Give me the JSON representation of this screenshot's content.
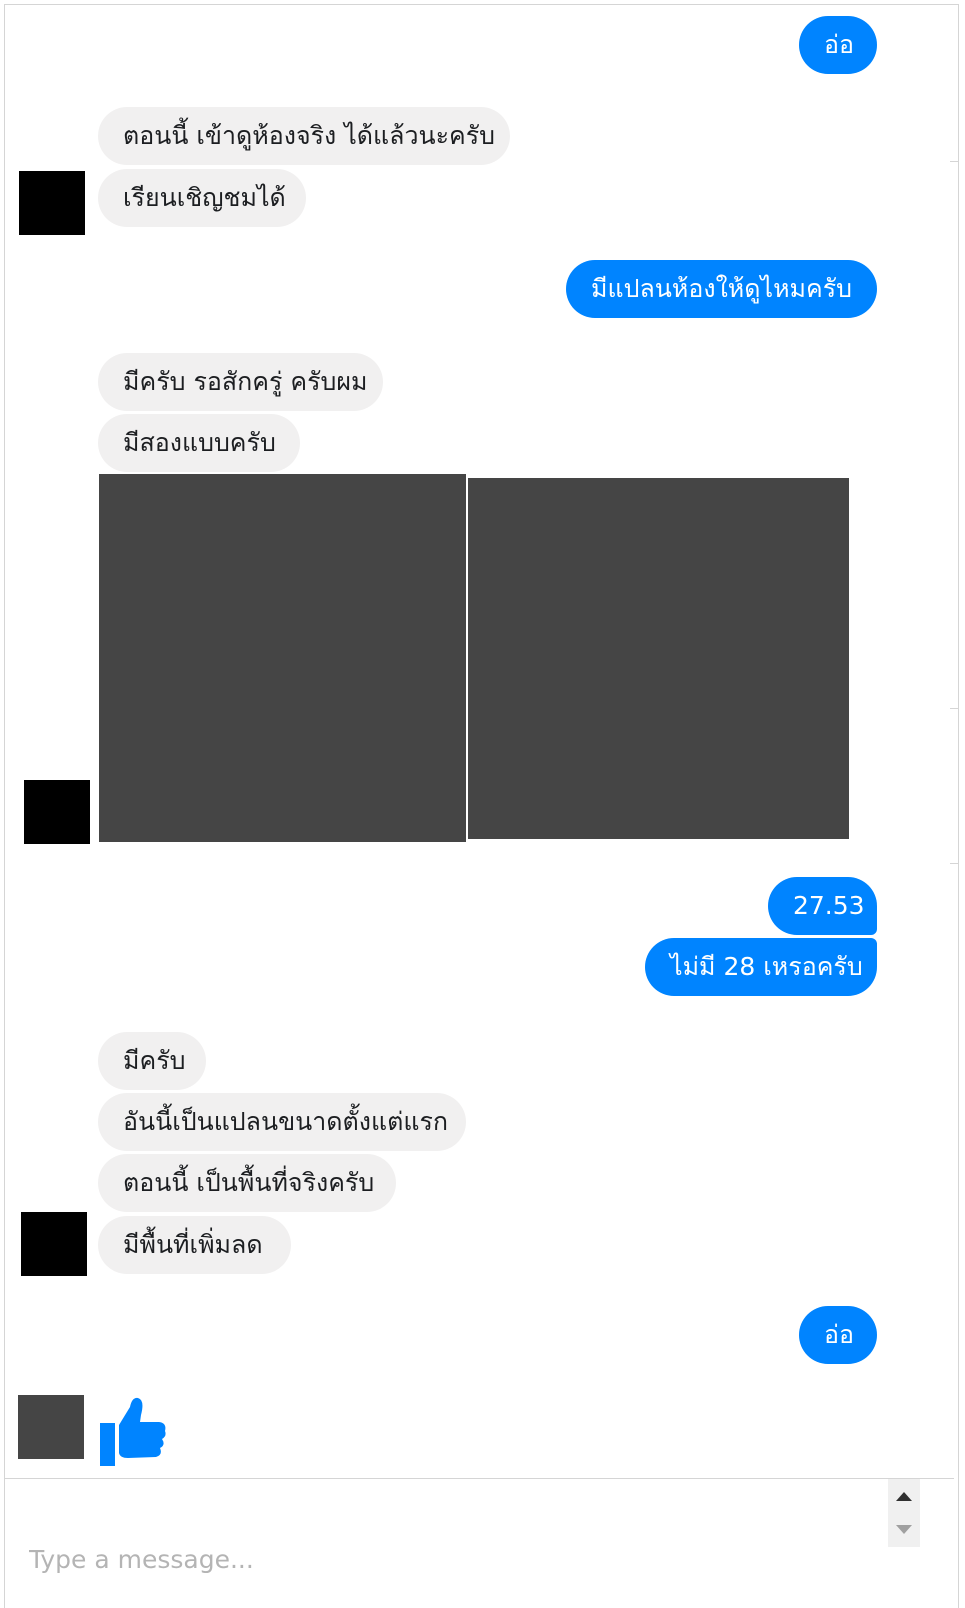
{
  "conversation": {
    "messages": [
      {
        "from": "me",
        "text": "อ่อ"
      },
      {
        "from": "other",
        "text": "ตอนนี้ เข้าดูห้องจริง ได้แล้วนะครับ"
      },
      {
        "from": "other",
        "text": "เรียนเชิญชมได้"
      },
      {
        "from": "me",
        "text": "มีแปลนห้องให้ดูไหมครับ"
      },
      {
        "from": "other",
        "text": "มีครับ รอสักครู่ ครับผม"
      },
      {
        "from": "other",
        "text": "มีสองแบบครับ"
      },
      {
        "from": "me",
        "text": "27.53"
      },
      {
        "from": "me",
        "text": "ไม่มี 28 เหรอครับ"
      },
      {
        "from": "other",
        "text": "มีครับ"
      },
      {
        "from": "other",
        "text": "อันนี้เป็นแปลนขนาดตั้งแต่แรก"
      },
      {
        "from": "other",
        "text": "ตอนนี้ เป็นพื้นที่จริงครับ"
      },
      {
        "from": "other",
        "text": "มีพื้นที่เพิ่มลด"
      },
      {
        "from": "me",
        "text": "อ่อ"
      }
    ],
    "like_icon": "thumbs-up-icon"
  },
  "composer": {
    "placeholder": "Type a message..."
  },
  "colors": {
    "outgoing_bubble": "#0084ff",
    "incoming_bubble": "#f1f0f0",
    "redacted_image": "#454545"
  }
}
